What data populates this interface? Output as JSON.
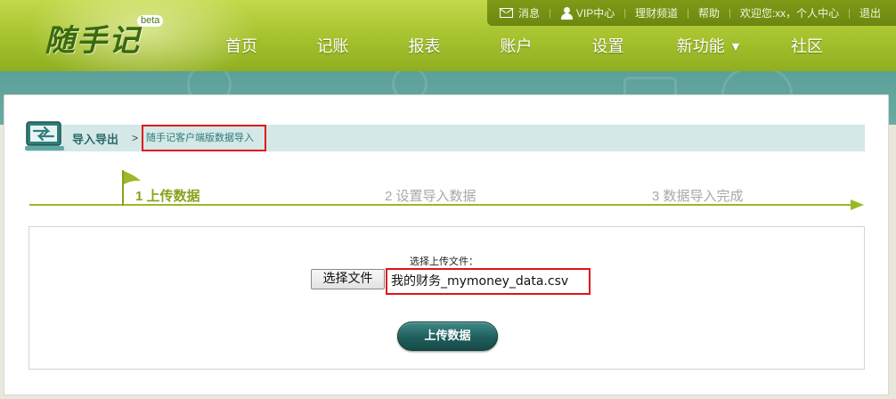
{
  "logo": {
    "text": "随手记",
    "badge": "beta"
  },
  "topbar": {
    "messages": "消息",
    "vip": "VIP中心",
    "finance": "理财频道",
    "help": "帮助",
    "welcome": "欢迎您:xx，个人中心",
    "logout": "退出"
  },
  "nav": {
    "items": [
      {
        "label": "首页"
      },
      {
        "label": "记账"
      },
      {
        "label": "报表"
      },
      {
        "label": "账户"
      },
      {
        "label": "设置"
      },
      {
        "label": "新功能"
      },
      {
        "label": "社区"
      }
    ]
  },
  "breadcrumb": {
    "title": "导入导出",
    "separator": ">",
    "current": "随手记客户端版数据导入"
  },
  "steps": [
    {
      "label": "1 上传数据"
    },
    {
      "label": "2 设置导入数据"
    },
    {
      "label": "3 数据导入完成"
    }
  ],
  "upload": {
    "label": "选择上传文件：",
    "choose_button": "选择文件",
    "file_name": "我的财务_mymoney_data.csv",
    "submit": "上传数据"
  },
  "colors": {
    "header_green": "#a9c531",
    "accent_teal": "#1f5e5c",
    "highlight_red": "#e0141a"
  }
}
